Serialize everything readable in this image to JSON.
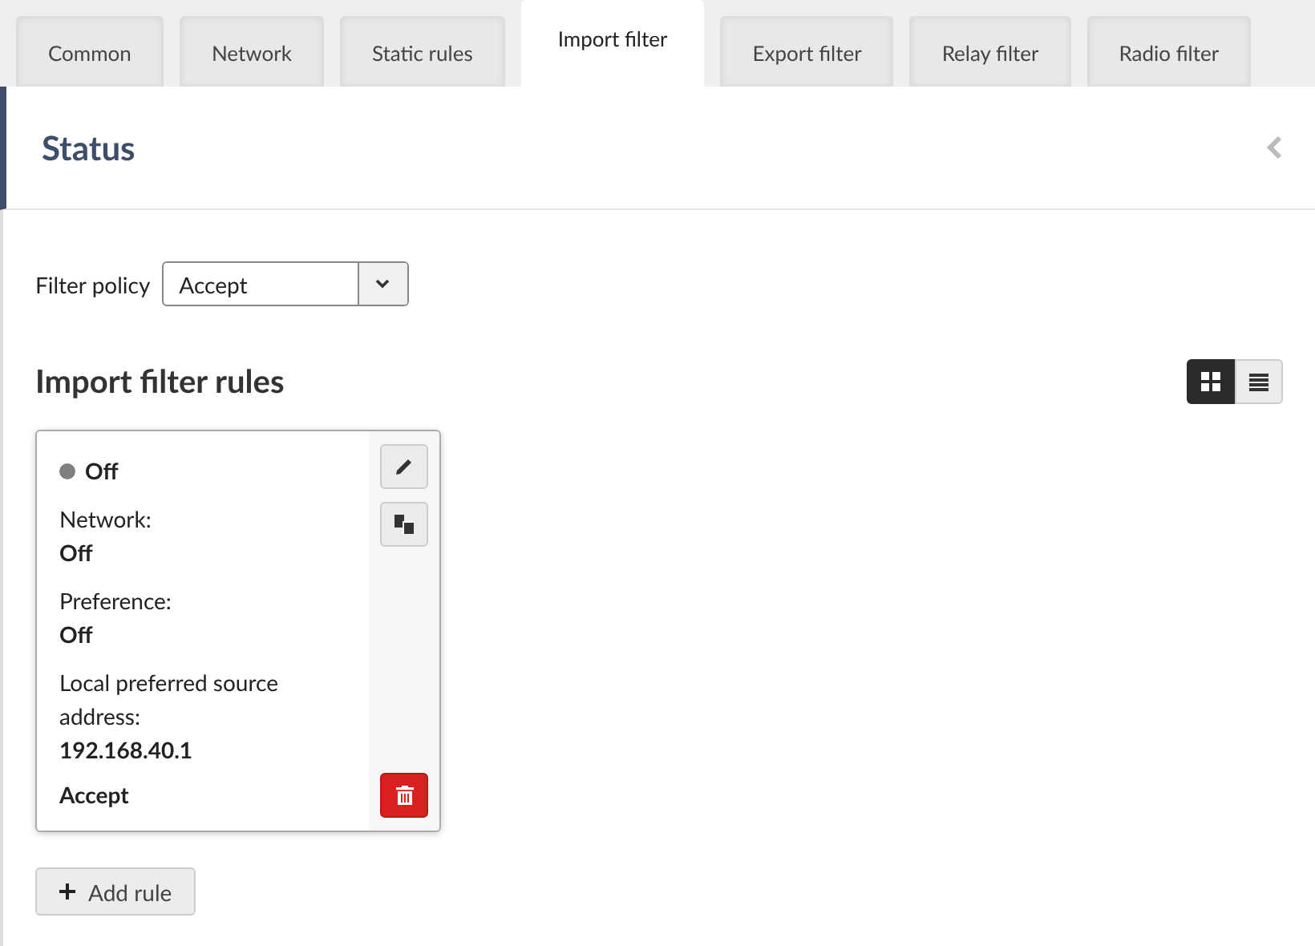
{
  "tabs": [
    {
      "label": "Common",
      "selected": false
    },
    {
      "label": "Network",
      "selected": false
    },
    {
      "label": "Static rules",
      "selected": false
    },
    {
      "label": "Import filter",
      "selected": true
    },
    {
      "label": "Export filter",
      "selected": false
    },
    {
      "label": "Relay filter",
      "selected": false
    },
    {
      "label": "Radio filter",
      "selected": false
    }
  ],
  "status": {
    "title": "Status",
    "expanded": false
  },
  "filter_policy": {
    "label": "Filter policy",
    "value": "Accept"
  },
  "rules_section": {
    "title": "Import filter rules",
    "views": [
      {
        "kind": "grid",
        "selected": true
      },
      {
        "kind": "list",
        "selected": false
      }
    ]
  },
  "rules": [
    {
      "status": "Off",
      "color": "#808080",
      "fields": [
        {
          "label": "Network:",
          "value": "Off"
        },
        {
          "label": "Preference:",
          "value": "Off"
        },
        {
          "label": "Local preferred source address:",
          "value": "192.168.40.1"
        }
      ],
      "action": "Accept"
    }
  ],
  "add_button": {
    "label": "Add rule"
  }
}
